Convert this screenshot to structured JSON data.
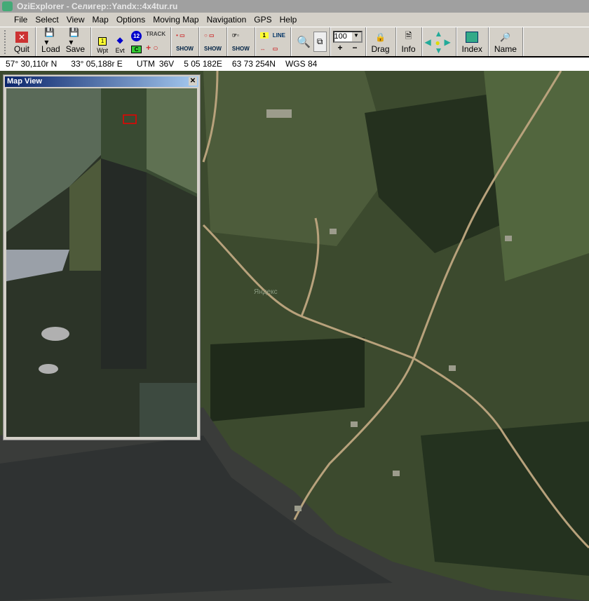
{
  "window": {
    "title": "OziExplorer - Селигер::Yandx::4x4tur.ru"
  },
  "menu": [
    "File",
    "Select",
    "View",
    "Map",
    "Options",
    "Moving Map",
    "Navigation",
    "GPS",
    "Help"
  ],
  "toolbar": {
    "quit": "Quit",
    "load": "Load",
    "save": "Save",
    "wpt": "Wpt",
    "evt": "Evt",
    "track": "TRACK",
    "show": "SHOW",
    "line": "LINE",
    "zoom_value": "100",
    "plus": "+",
    "minus": "−",
    "drag": "Drag",
    "info": "Info",
    "index": "Index",
    "name": "Name",
    "num12": "12",
    "c": "C",
    "one": "1"
  },
  "status": {
    "lat": "57° 30,110r N",
    "lon": "33° 05,188r E",
    "utm": "UTM",
    "zone": "36V",
    "easting": "5 05 182E",
    "northing": "63 73 254N",
    "datum": "WGS 84"
  },
  "mapview": {
    "title": "Map View"
  },
  "map": {
    "watermark": "Яндекс"
  }
}
